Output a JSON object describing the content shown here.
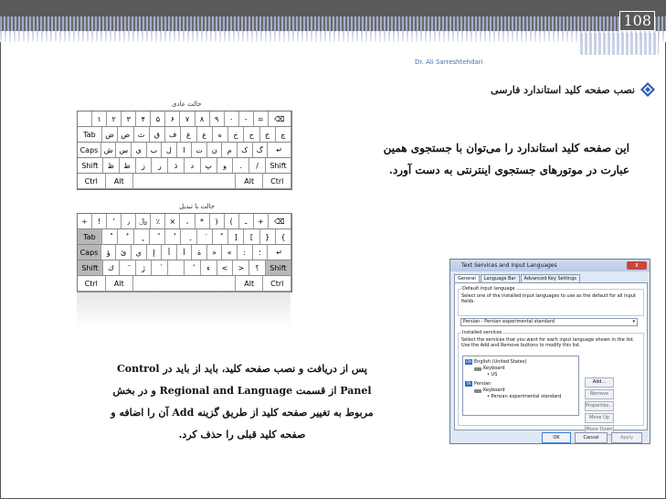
{
  "page_number": "108",
  "author": "Dr. Ali Sarreshtehdari",
  "heading": "نصب صفحه کلید استاندارد فارسی",
  "paragraph_top": "این صفحه کلید استاندارد را می‌توان با جستجوی همین عبارت در موتورهای جستجوی اینترنتی به دست آورد.",
  "paragraph_bottom": "پس از دریافت و نصب صفحه کلید، باید از باید در Control Panel از قسمت Regional and Language و در بخش مربوط به تغییر صفحه کلید از طریق گزینه Add آن را اضافه و صفحه کلید قبلی را حذف کرد.",
  "keyboard_normal_title": "حالت عادی",
  "keyboard_shift_title": "حالت با تبدیل",
  "keyboard_normal_rows": [
    [
      "‍",
      "۱",
      "۲",
      "۳",
      "۴",
      "۵",
      "۶",
      "۷",
      "۸",
      "۹",
      "۰",
      "-",
      "=",
      "⌫"
    ],
    [
      "Tab",
      "ض",
      "ص",
      "ث",
      "ق",
      "ف",
      "غ",
      "ع",
      "ه",
      "خ",
      "ح",
      "ج",
      "چ"
    ],
    [
      "Caps",
      "ش",
      "س",
      "ی",
      "ب",
      "ل",
      "ا",
      "ت",
      "ن",
      "م",
      "ک",
      "گ",
      "↵"
    ],
    [
      "Shift",
      "ظ",
      "ط",
      "ز",
      "ر",
      "ذ",
      "د",
      "پ",
      "و",
      ".",
      "/",
      "Shift"
    ],
    [
      "Ctrl",
      "Alt",
      "",
      "Alt",
      "Ctrl"
    ]
  ],
  "keyboard_shift_rows": [
    [
      "÷",
      "!",
      "٬",
      "٫",
      "﷼",
      "٪",
      "×",
      "،",
      "*",
      ")",
      "(",
      "ـ",
      "+",
      "⌫"
    ],
    [
      "Tab",
      "ْ",
      "ٌ",
      "ٍ",
      "ً",
      "ُ",
      "ِ",
      "َ",
      "ّ",
      "]",
      "[",
      "}",
      "{"
    ],
    [
      "Caps",
      "ؤ",
      "ئ",
      "ي",
      "إ",
      "أ",
      "آ",
      "ة",
      "»",
      "«",
      ":",
      "؛",
      "↵"
    ],
    [
      "Shift",
      "ك",
      "ٓ",
      "ژ",
      "ٰ",
      "‌",
      "ٔ",
      "ء",
      "<",
      ">",
      "؟",
      "Shift"
    ],
    [
      "Ctrl",
      "Alt",
      "",
      "Alt",
      "Ctrl"
    ]
  ],
  "dialog": {
    "title": "Text Services and Input Languages",
    "close_label": "x",
    "tabs": [
      "General",
      "Language Bar",
      "Advanced Key Settings"
    ],
    "default_input_title": "Default input language",
    "default_input_desc": "Select one of the installed input languages to use as the default for all input fields.",
    "default_input_value": "Persian - Persian experimental standard",
    "installed_title": "Installed services",
    "installed_desc": "Select the services that you want for each input language shown in the list. Use the Add and Remove buttons to modify this list.",
    "tree": {
      "lang1_code": "EN",
      "lang1": "English (United States)",
      "lang1_kb": "Keyboard",
      "lang1_item": "US",
      "lang2_code": "FA",
      "lang2": "Persian",
      "lang2_kb": "Keyboard",
      "lang2_item": "Persian experimental standard"
    },
    "side_buttons": [
      "Add...",
      "Remove",
      "Properties...",
      "Move Up",
      "Move Down"
    ],
    "footer_buttons": [
      "OK",
      "Cancel",
      "Apply"
    ]
  },
  "colors": {
    "band": "#5a5a5a",
    "accent": "#4d6fb0",
    "diamond": "#2d5fb0"
  },
  "icons": {
    "heading_bullet": "diamond-bullet-icon",
    "dialog": "keyboard-icon"
  }
}
